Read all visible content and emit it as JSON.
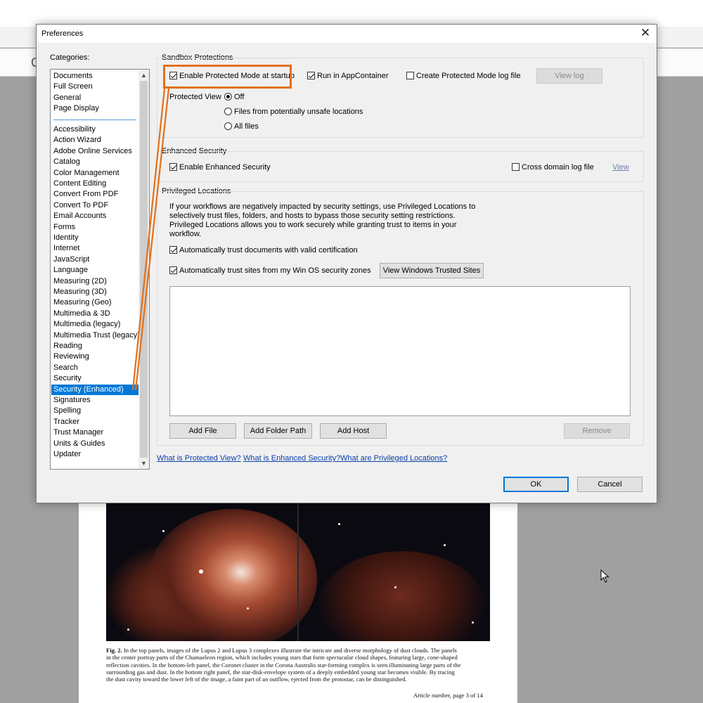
{
  "dialog": {
    "title": "Preferences",
    "categories_label": "Categories:",
    "categories_top": [
      "Documents",
      "Full Screen",
      "General",
      "Page Display"
    ],
    "categories": [
      "Accessibility",
      "Action Wizard",
      "Adobe Online Services",
      "Catalog",
      "Color Management",
      "Content Editing",
      "Convert From PDF",
      "Convert To PDF",
      "Email Accounts",
      "Forms",
      "Identity",
      "Internet",
      "JavaScript",
      "Language",
      "Measuring (2D)",
      "Measuring (3D)",
      "Measuring (Geo)",
      "Multimedia & 3D",
      "Multimedia (legacy)",
      "Multimedia Trust (legacy)",
      "Reading",
      "Reviewing",
      "Search",
      "Security",
      "Security (Enhanced)",
      "Signatures",
      "Spelling",
      "Tracker",
      "Trust Manager",
      "Units & Guides",
      "Updater"
    ],
    "selected_category": "Security (Enhanced)",
    "sandbox": {
      "title": "Sandbox Protections",
      "protected_mode": {
        "label": "Enable Protected Mode at startup",
        "checked": true
      },
      "app_container": {
        "label": "Run in AppContainer",
        "checked": true
      },
      "log_file": {
        "label": "Create Protected Mode log file",
        "checked": false
      },
      "view_log": "View log",
      "protected_view_label": "Protected View",
      "pv_options": [
        {
          "label": "Off",
          "selected": true
        },
        {
          "label": "Files from potentially unsafe locations",
          "selected": false
        },
        {
          "label": "All files",
          "selected": false
        }
      ]
    },
    "enhanced": {
      "title": "Enhanced Security",
      "enable": {
        "label": "Enable Enhanced Security",
        "checked": true
      },
      "cross_domain": {
        "label": "Cross domain log file",
        "checked": false
      },
      "view": "View"
    },
    "privileged": {
      "title": "Privileged Locations",
      "desc_lines": [
        "If your workflows are negatively impacted by security settings, use Privileged Locations to",
        "selectively trust files, folders, and hosts to bypass those security setting restrictions.",
        "Privileged Locations allows you to work securely while granting trust to items in your",
        "workflow."
      ],
      "trust_cert": {
        "label": "Automatically trust documents with valid certification",
        "checked": true
      },
      "trust_sites": {
        "label": "Automatically trust sites from my Win OS security zones",
        "checked": true
      },
      "view_trusted": "View Windows Trusted Sites",
      "add_file": "Add File",
      "add_folder": "Add Folder Path",
      "add_host": "Add Host",
      "remove": "Remove"
    },
    "links": [
      "What is Protected View?",
      "What is Enhanced Security?",
      "What are Privileged Locations?"
    ],
    "ok": "OK",
    "cancel": "Cancel"
  },
  "document": {
    "caption_label": "Fig. 2.",
    "caption_lines": [
      "In the top panels, images of the Lupus 2 and Lupus 3 complexes illustrate the intricate and diverse morphology of dust clouds. The panels",
      "in the center portray parts of the Chamaeleon region, which includes young stars that form spectacular cloud shapes, featuring large, cone-shaped",
      "reflection cavities. In the bottom-left panel, the Coronet cluster in the Corona Australis star-forming complex is seen illuminating large parts of the",
      "surrounding gas and dust. In the bottom right panel, the star-disk-envelope system of a deeply embedded young star becomes visible. By tracing",
      "the dust cavity toward the lower left of the image, a faint part of an outflow, ejected from the protostar, can be distinguished."
    ],
    "page_number": "Article number, page 3 of 14"
  },
  "colors": {
    "highlight": "#e2701b",
    "selection": "#0078d7"
  }
}
